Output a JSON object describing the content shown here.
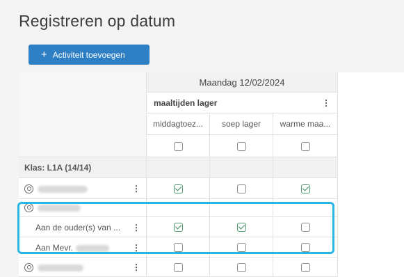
{
  "page": {
    "title": "Registreren op datum"
  },
  "toolbar": {
    "add_label": "Activiteit toevoegen",
    "add_icon": "plus-icon"
  },
  "table": {
    "date_header": "Maandag 12/02/2024",
    "group": {
      "label": "maaltijden lager",
      "menu": "⋮"
    },
    "columns": [
      "middagtoez...",
      "soep lager",
      "warme maa..."
    ],
    "class_row": {
      "label": "Klas: L1A (14/14)"
    },
    "rows": [
      {
        "label": "",
        "menu": "⋮",
        "checks": [
          true,
          false,
          true
        ],
        "type": "student"
      },
      {
        "label": "",
        "menu": "",
        "checks": [],
        "type": "student-header"
      },
      {
        "label": "Aan de ouder(s) van ...",
        "menu": "⋮",
        "checks": [
          true,
          true,
          false
        ],
        "type": "sub"
      },
      {
        "label": "Aan Mevr.",
        "menu": "⋮",
        "checks": [
          false,
          false,
          false
        ],
        "type": "sub"
      },
      {
        "label": "",
        "menu": "⋮",
        "checks": [
          false,
          false,
          false
        ],
        "type": "student"
      }
    ]
  },
  "colors": {
    "accent": "#2e7fc4",
    "highlight": "#29b6e3",
    "check": "#3c8a5d"
  }
}
